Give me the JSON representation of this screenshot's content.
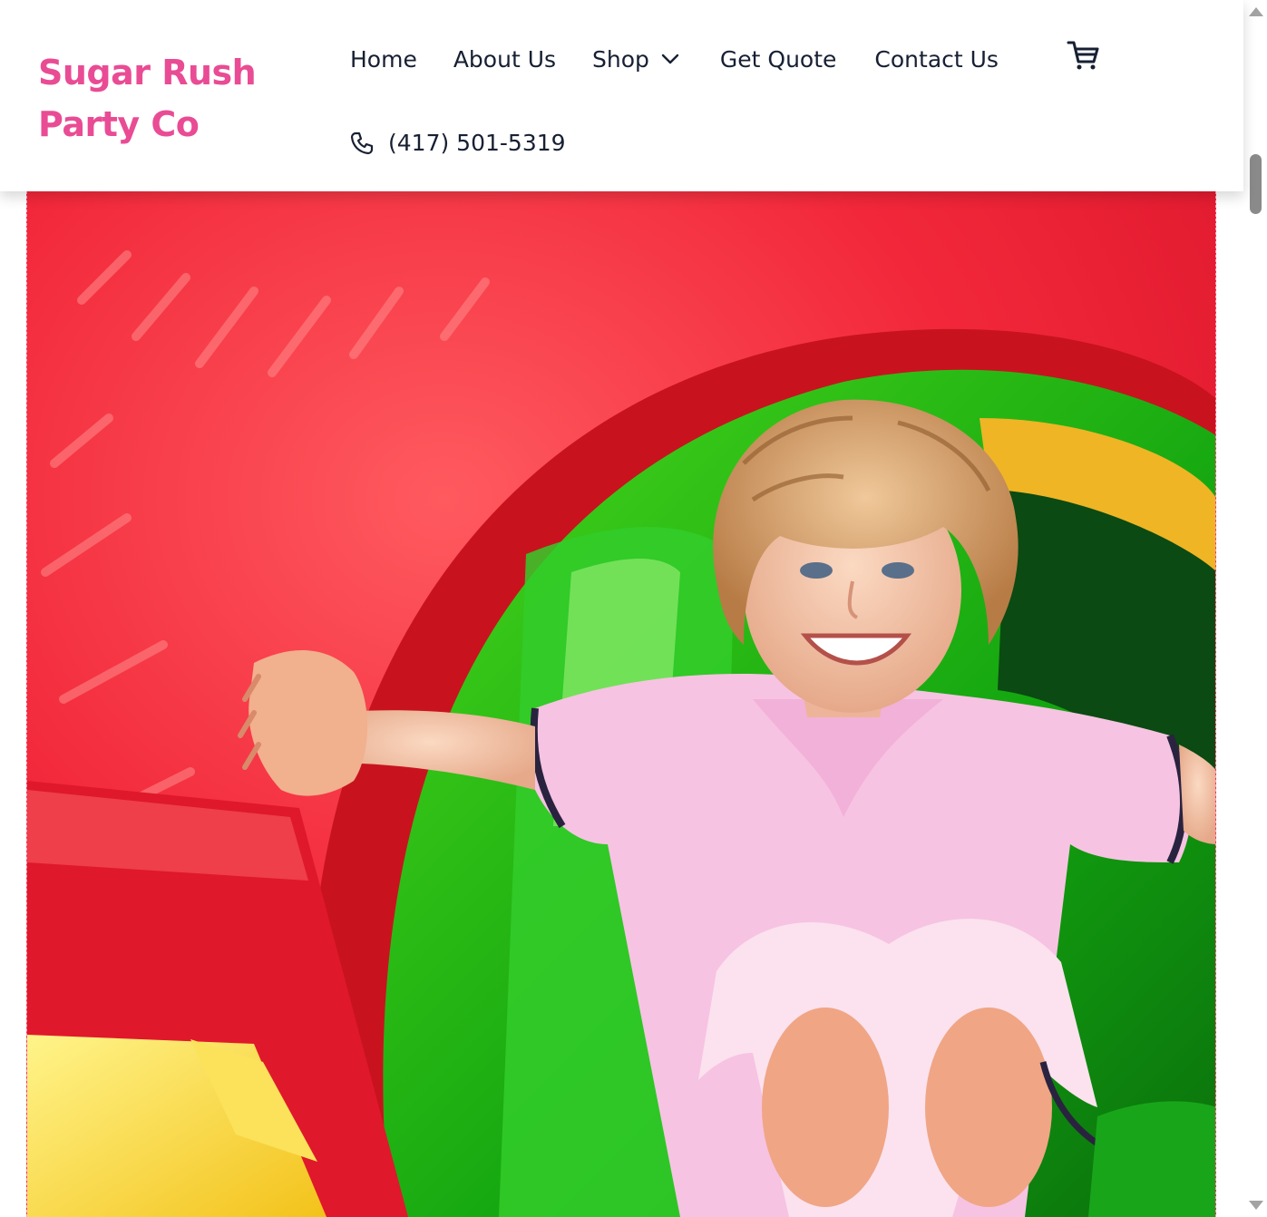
{
  "header": {
    "logo_text": "Sugar Rush Party Co",
    "brand_color": "#e94c94",
    "nav": {
      "home": "Home",
      "about": "About Us",
      "shop": "Shop",
      "quote": "Get Quote",
      "contact": "Contact Us"
    },
    "phone": "(417) 501-5319",
    "icons": {
      "shop_dropdown": "chevron-down-icon",
      "cart": "cart-icon",
      "phone": "phone-icon"
    }
  },
  "hero": {
    "image": "smiling-child-in-inflatable-bounce-house"
  }
}
